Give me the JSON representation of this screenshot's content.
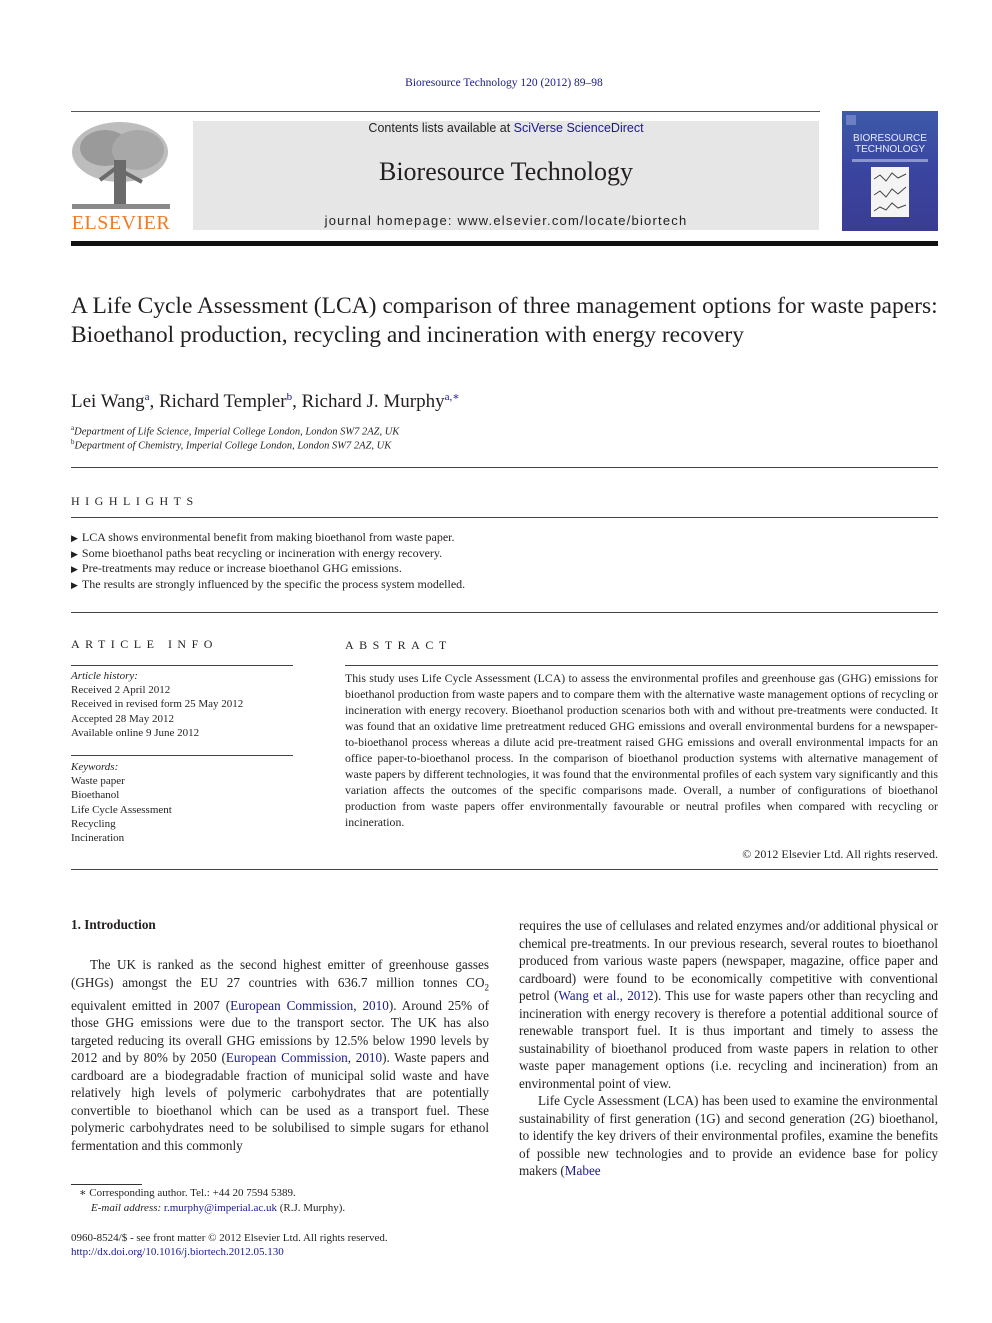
{
  "header": {
    "citation": "Bioresource Technology 120 (2012) 89–98",
    "contents_prefix": "Contents lists available at ",
    "contents_link": "SciVerse ScienceDirect",
    "journal_title": "Bioresource Technology",
    "homepage": "journal homepage: www.elsevier.com/locate/biortech",
    "publisher_logo_text": "ELSEVIER",
    "cover": {
      "line1": "BIORESOURCE",
      "line2": "TECHNOLOGY"
    },
    "accent_color": "#f47920",
    "link_color": "#1a1a8c"
  },
  "article": {
    "title": "A Life Cycle Assessment (LCA) comparison of three management options for waste papers: Bioethanol production, recycling and incineration with energy recovery",
    "authors": [
      {
        "name": "Lei Wang",
        "sup": "a"
      },
      {
        "name": "Richard Templer",
        "sup": "b"
      },
      {
        "name": "Richard J. Murphy",
        "sup": "a,∗"
      }
    ],
    "affiliations": [
      {
        "sup": "a",
        "text": "Department of Life Science, Imperial College London, London SW7 2AZ, UK"
      },
      {
        "sup": "b",
        "text": "Department of Chemistry, Imperial College London, London SW7 2AZ, UK"
      }
    ]
  },
  "highlights": {
    "heading": "HIGHLIGHTS",
    "items": [
      "LCA shows environmental benefit from making bioethanol from waste paper.",
      "Some bioethanol paths beat recycling or incineration with energy recovery.",
      "Pre-treatments may reduce or increase bioethanol GHG emissions.",
      "The results are strongly influenced by the specific the process system modelled."
    ]
  },
  "article_info": {
    "heading": "ARTICLE INFO",
    "history_label": "Article history:",
    "history": [
      "Received 2 April 2012",
      "Received in revised form 25 May 2012",
      "Accepted 28 May 2012",
      "Available online 9 June 2012"
    ],
    "keywords_label": "Keywords:",
    "keywords": [
      "Waste paper",
      "Bioethanol",
      "Life Cycle Assessment",
      "Recycling",
      "Incineration"
    ]
  },
  "abstract": {
    "heading": "ABSTRACT",
    "text": "This study uses Life Cycle Assessment (LCA) to assess the environmental profiles and greenhouse gas (GHG) emissions for bioethanol production from waste papers and to compare them with the alternative waste management options of recycling or incineration with energy recovery. Bioethanol production scenarios both with and without pre-treatments were conducted. It was found that an oxidative lime pretreatment reduced GHG emissions and overall environmental burdens for a newspaper-to-bioethanol process whereas a dilute acid pre-treatment raised GHG emissions and overall environmental impacts for an office paper-to-bioethanol process. In the comparison of bioethanol production systems with alternative management of waste papers by different technologies, it was found that the environmental profiles of each system vary significantly and this variation affects the outcomes of the specific comparisons made. Overall, a number of configurations of bioethanol production from waste papers offer environmentally favourable or neutral profiles when compared with recycling or incineration.",
    "copyright": "© 2012 Elsevier Ltd. All rights reserved."
  },
  "intro": {
    "heading": "1. Introduction",
    "p1_a": "The UK is ranked as the second highest emitter of greenhouse gasses (GHGs) amongst the EU 27 countries with 636.7 million tonnes CO",
    "p1_sub": "2",
    "p1_b": " equivalent emitted in 2007 (",
    "ref1": "European Commission, 2010",
    "p1_c": "). Around 25% of those GHG emissions were due to the transport sector. The UK has also targeted reducing its overall GHG emissions by 12.5% below 1990 levels by 2012 and by 80% by 2050 (",
    "ref2": "European Commission, 2010",
    "p1_d": "). Waste papers and cardboard are a biodegradable fraction of municipal solid waste and have relatively high levels of polymeric carbohydrates that are potentially convertible to bioethanol which can be used as a transport fuel. These polymeric carbohydrates need to be solubilised to simple sugars for ethanol fermentation and this commonly requires the use of cellulases and related enzymes and/or additional physical or chemical pre-treatments. In our previous research, several routes to bioethanol produced from various waste papers (newspaper, magazine, office paper and cardboard) were found to be economically competitive with conventional petrol (",
    "ref3": "Wang et al., 2012",
    "p1_e": "). This use for waste papers other than recycling and incineration with energy recovery is therefore a potential additional source of renewable transport fuel. It is thus important and timely to assess the sustainability of bioethanol produced from waste papers in relation to other waste paper management options (i.e. recycling and incineration) from an environmental point of view.",
    "p2_a": "Life Cycle Assessment (LCA) has been used to examine the environmental sustainability of first generation (1G) and second generation (2G) bioethanol, to identify the key drivers of their environmental profiles, examine the benefits of possible new technologies and to provide an evidence base for policy makers (",
    "ref4": "Mabee"
  },
  "footnotes": {
    "corresponding": "∗  Corresponding author. Tel.: +44 20 7594 5389.",
    "email_label": "E-mail address: ",
    "email": "r.murphy@imperial.ac.uk",
    "email_suffix": " (R.J. Murphy).",
    "issn": "0960-8524/$ - see front matter © 2012 Elsevier Ltd. All rights reserved.",
    "doi": "http://dx.doi.org/10.1016/j.biortech.2012.05.130"
  }
}
